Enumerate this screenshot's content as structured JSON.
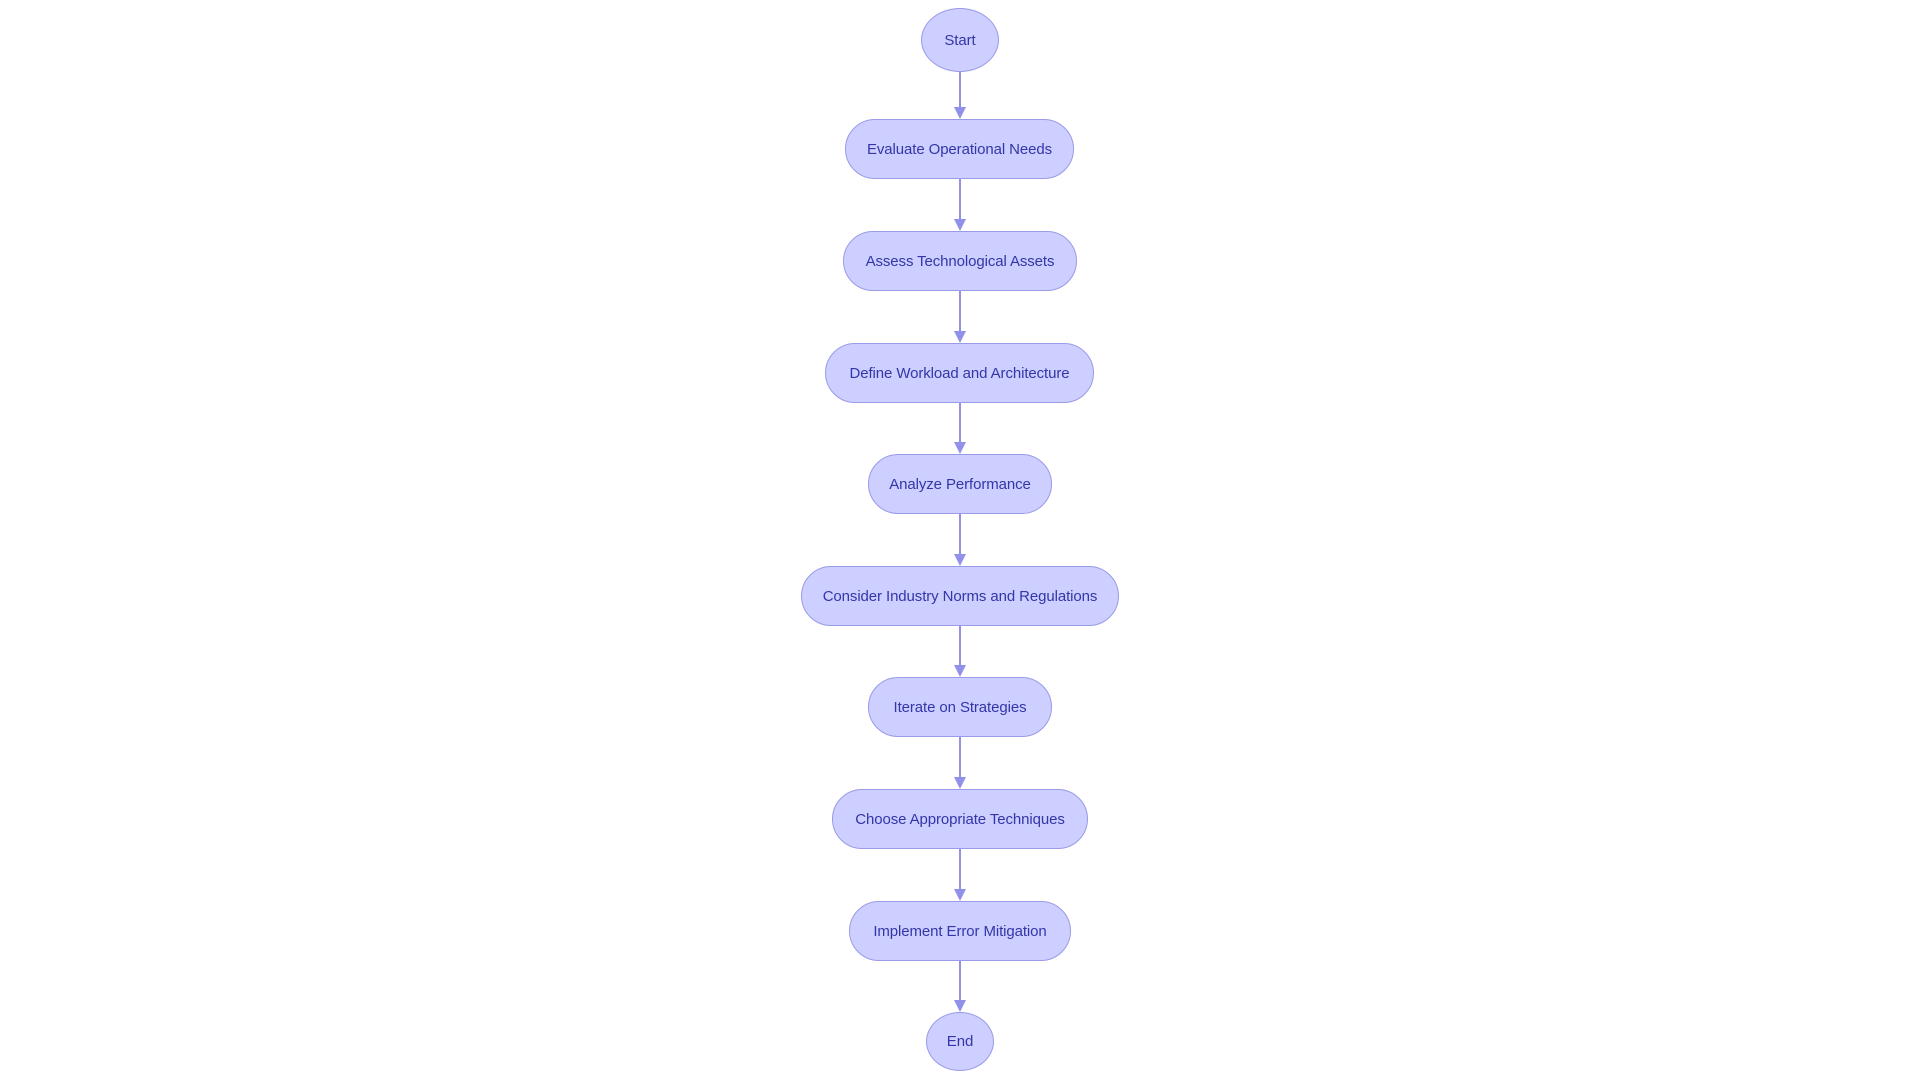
{
  "diagram": {
    "type": "flowchart",
    "direction": "top-to-bottom",
    "colors": {
      "node_fill": "#cccfff",
      "node_stroke": "#9a9ae8",
      "node_text": "#3535a8",
      "edge": "#9191ea",
      "background": "#ffffff"
    },
    "nodes": [
      {
        "id": "start",
        "label": "Start",
        "shape": "circle"
      },
      {
        "id": "evaluate",
        "label": "Evaluate Operational Needs",
        "shape": "stadium"
      },
      {
        "id": "assess",
        "label": "Assess Technological Assets",
        "shape": "stadium"
      },
      {
        "id": "define",
        "label": "Define Workload and Architecture",
        "shape": "stadium"
      },
      {
        "id": "analyze",
        "label": "Analyze Performance",
        "shape": "stadium"
      },
      {
        "id": "consider",
        "label": "Consider Industry Norms and Regulations",
        "shape": "stadium"
      },
      {
        "id": "iterate",
        "label": "Iterate on Strategies",
        "shape": "stadium"
      },
      {
        "id": "choose",
        "label": "Choose Appropriate Techniques",
        "shape": "stadium"
      },
      {
        "id": "implement",
        "label": "Implement Error Mitigation",
        "shape": "stadium"
      },
      {
        "id": "end",
        "label": "End",
        "shape": "circle"
      }
    ],
    "edges": [
      {
        "from": "start",
        "to": "evaluate"
      },
      {
        "from": "evaluate",
        "to": "assess"
      },
      {
        "from": "assess",
        "to": "define"
      },
      {
        "from": "define",
        "to": "analyze"
      },
      {
        "from": "analyze",
        "to": "consider"
      },
      {
        "from": "consider",
        "to": "iterate"
      },
      {
        "from": "iterate",
        "to": "choose"
      },
      {
        "from": "choose",
        "to": "implement"
      },
      {
        "from": "implement",
        "to": "end"
      }
    ]
  }
}
